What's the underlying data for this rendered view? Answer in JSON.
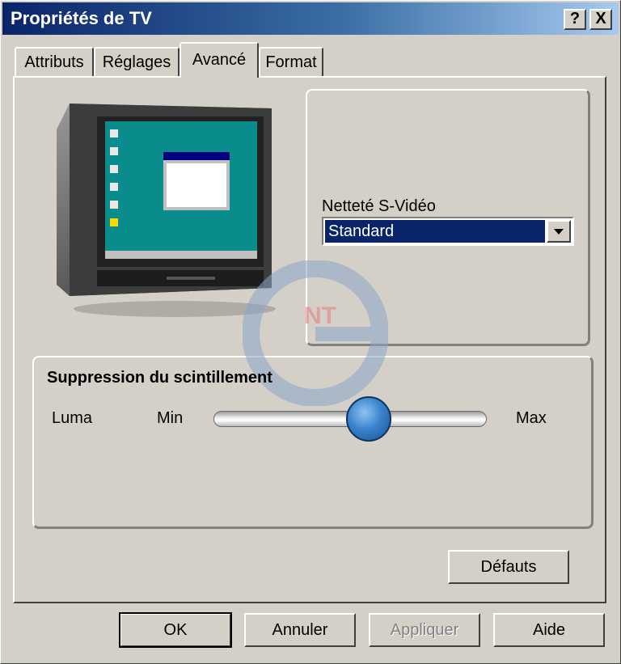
{
  "window": {
    "title": "Propriétés de TV"
  },
  "titlebar_buttons": {
    "help": "?",
    "close": "X"
  },
  "tabs": [
    {
      "label": "Attributs",
      "active": false
    },
    {
      "label": "Réglages",
      "active": false
    },
    {
      "label": "Avancé",
      "active": true
    },
    {
      "label": "Format",
      "active": false
    }
  ],
  "sharpness": {
    "label": "Netteté S-Vidéo",
    "value": "Standard"
  },
  "flicker": {
    "title": "Suppression du scintillement",
    "luma_label": "Luma",
    "min_label": "Min",
    "max_label": "Max",
    "slider_value": 0.58
  },
  "buttons": {
    "defaults": "Défauts",
    "ok": "OK",
    "cancel": "Annuler",
    "apply": "Appliquer",
    "help": "Aide"
  },
  "watermark": {
    "big": "G",
    "small": "NT"
  },
  "colors": {
    "title_start": "#0a246a",
    "title_end": "#a6caf0",
    "selection": "#0a246a",
    "thumb": "#3b84cf"
  }
}
